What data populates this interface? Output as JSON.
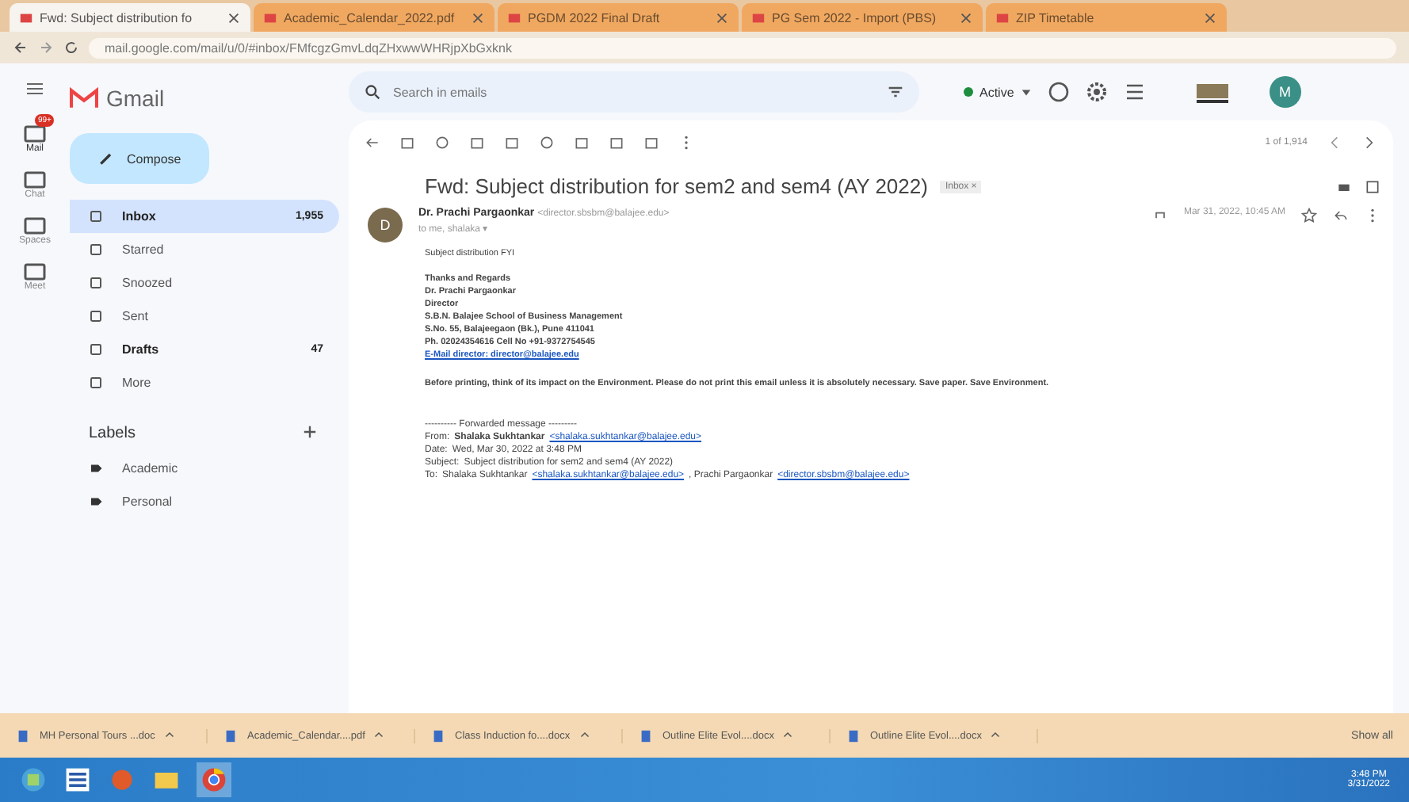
{
  "browser": {
    "tabs": [
      {
        "title": "Fwd: Subject distribution fo",
        "selected": true
      },
      {
        "title": "Academic_Calendar_2022.pdf",
        "selected": false
      },
      {
        "title": "PGDM 2022 Final Draft",
        "selected": false
      },
      {
        "title": "PG Sem 2022 - Import (PBS)",
        "selected": false
      },
      {
        "title": "ZIP Timetable",
        "selected": false
      }
    ],
    "address": "mail.google.com/mail/u/0/#inbox/FMfcgzGmvLdqZHxwwWHRjpXbGxknk"
  },
  "rail": [
    {
      "label": "Mail",
      "selected": true,
      "badge": "99+"
    },
    {
      "label": "Chat",
      "selected": false
    },
    {
      "label": "Spaces",
      "selected": false
    },
    {
      "label": "Meet",
      "selected": false
    }
  ],
  "app": {
    "name": "Gmail",
    "search_placeholder": "Search in emails",
    "status": "Active",
    "avatar": "M"
  },
  "compose": "Compose",
  "folders": [
    {
      "label": "Inbox",
      "count": "1,955",
      "selected": true,
      "bold": true
    },
    {
      "label": "Starred",
      "selected": false,
      "bold": false
    },
    {
      "label": "Snoozed",
      "selected": false,
      "bold": false
    },
    {
      "label": "Sent",
      "selected": false,
      "bold": false
    },
    {
      "label": "Drafts",
      "count": "47",
      "selected": false,
      "bold": true
    },
    {
      "label": "More",
      "selected": false,
      "bold": false
    }
  ],
  "labels": {
    "title": "Labels",
    "items": [
      "Academic",
      "Personal"
    ]
  },
  "pager": "1 of 1,914",
  "email": {
    "subject": "Fwd: Subject distribution for sem2 and sem4 (AY 2022)",
    "tag": "Inbox ×",
    "sender": "Dr. Prachi Pargaonkar",
    "sender_address": "<director.sbsbm@balajee.edu>",
    "to": "to me, shalaka ▾",
    "time": "Mar 31, 2022, 10:45 AM",
    "avatar": "D",
    "body": [
      "Subject distribution FYI"
    ],
    "signature": [
      "Thanks and Regards",
      "Dr. Prachi Pargaonkar",
      "Director",
      "S.B.N. Balajee School of Business Management",
      "S.No. 55, Balajeegaon (Bk.), Pune 411041",
      "Ph. 02024354616 Cell No +91-9372754545"
    ],
    "signature_link": "E-Mail director: director@balajee.edu",
    "note": "Before printing, think of its impact on the Environment. Please do not print this email unless it is absolutely necessary. Save paper. Save Environment.",
    "forwarded": {
      "heading": "---------- Forwarded message ---------",
      "lines": [
        {
          "label": "From:",
          "name": "Shalaka Sukhtankar",
          "link": "<shalaka.sukhtankar@balajee.edu>"
        },
        {
          "label": "Date:",
          "text": "Wed, Mar 30, 2022 at 3:48 PM"
        },
        {
          "label": "Subject:",
          "text": "Subject distribution for sem2 and sem4 (AY 2022)"
        },
        {
          "label": "To:",
          "text": "Shalaka Sukhtankar",
          "link": "<shalaka.sukhtankar@balajee.edu>",
          "text2": ", Prachi Pargaonkar",
          "link2": "<director.sbsbm@balajee.edu>"
        }
      ]
    }
  },
  "downloads": {
    "items": [
      "MH Personal Tours ...doc",
      "Academic_Calendar....pdf",
      "Class Induction fo....docx",
      "Outline Elite Evol....docx",
      "Outline Elite Evol....docx"
    ],
    "show_all": "Show all"
  },
  "taskbar": {
    "time": "3:48 PM",
    "date": "3/31/2022"
  }
}
